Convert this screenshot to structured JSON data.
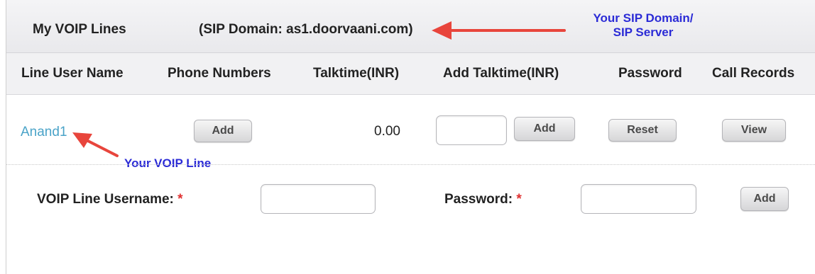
{
  "panel": {
    "title": "My VOIP Lines",
    "sip_domain_text": "(SIP Domain: as1.doorvaani.com)"
  },
  "columns": [
    "Line User Name",
    "Phone Numbers",
    "Talktime(INR)",
    "Add Talktime(INR)",
    "Password",
    "Call Records"
  ],
  "lines": [
    {
      "username": "Anand1",
      "phone_button": "Add",
      "talktime": "0.00",
      "add_talktime_value": "",
      "add_talktime_button": "Add",
      "password_button": "Reset",
      "records_button": "View"
    }
  ],
  "new_line_form": {
    "username_label": "VOIP Line Username:",
    "password_label": "Password:",
    "required_marker": "*",
    "username_value": "",
    "password_value": "",
    "submit_button": "Add"
  },
  "annotations": {
    "sip_domain_line1": "Your SIP Domain/",
    "sip_domain_line2": "SIP Server",
    "voip_line": "Your VOIP Line",
    "text_color": "#2b2bd6",
    "arrow_color": "#e8453c"
  }
}
